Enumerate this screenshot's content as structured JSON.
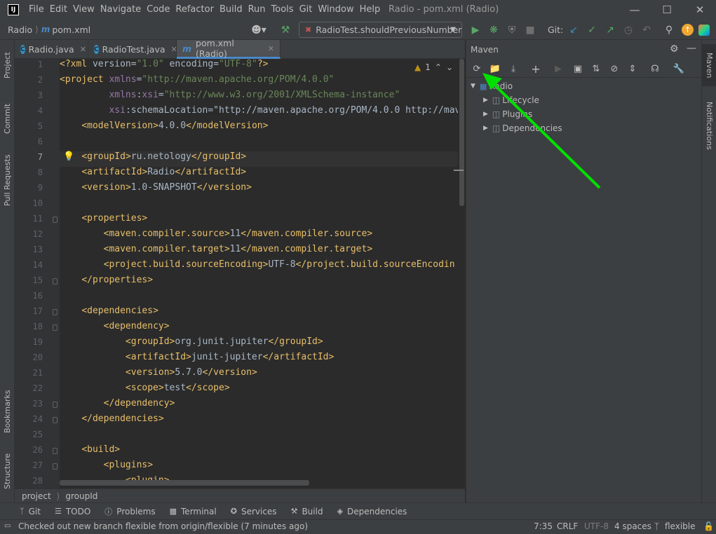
{
  "title_bar": {
    "menus": [
      "File",
      "Edit",
      "View",
      "Navigate",
      "Code",
      "Refactor",
      "Build",
      "Run",
      "Tools",
      "Git",
      "Window",
      "Help"
    ],
    "title": "Radio - pom.xml (Radio)"
  },
  "nav_bar": {
    "crumbs": [
      "Radio",
      "pom.xml"
    ],
    "run_config": "RadioTest.shouldPreviousNumber",
    "git_label": "Git:"
  },
  "left_strip": [
    "Project",
    "Commit",
    "Pull Requests",
    "Bookmarks",
    "Structure"
  ],
  "right_strip": [
    "Maven",
    "Notifications"
  ],
  "tabs": [
    {
      "label": "Radio.java",
      "icon": "C",
      "color": "#3592c4"
    },
    {
      "label": "RadioTest.java",
      "icon": "C",
      "color": "#3592c4"
    },
    {
      "label": "pom.xml (Radio)",
      "icon": "m",
      "color": "#4a88c7"
    }
  ],
  "editor": {
    "inspection": "1",
    "line_numbers": [
      "1",
      "2",
      "3",
      "4",
      "5",
      "6",
      "7",
      "8",
      "9",
      "10",
      "11",
      "12",
      "13",
      "14",
      "15",
      "16",
      "17",
      "18",
      "19",
      "20",
      "21",
      "22",
      "23",
      "24",
      "25",
      "26",
      "27",
      "28"
    ],
    "lines": [
      "<?xml version=\"1.0\" encoding=\"UTF-8\"?>",
      "<project xmlns=\"http://maven.apache.org/POM/4.0.0\"",
      "         xmlns:xsi=\"http://www.w3.org/2001/XMLSchema-instance\"",
      "         xsi:schemaLocation=\"http://maven.apache.org/POM/4.0.0 http://mav",
      "    <modelVersion>4.0.0</modelVersion>",
      "",
      "    <groupId>ru.netology</groupId>",
      "    <artifactId>Radio</artifactId>",
      "    <version>1.0-SNAPSHOT</version>",
      "",
      "    <properties>",
      "        <maven.compiler.source>11</maven.compiler.source>",
      "        <maven.compiler.target>11</maven.compiler.target>",
      "        <project.build.sourceEncoding>UTF-8</project.build.sourceEncodin",
      "    </properties>",
      "",
      "    <dependencies>",
      "        <dependency>",
      "            <groupId>org.junit.jupiter</groupId>",
      "            <artifactId>junit-jupiter</artifactId>",
      "            <version>5.7.0</version>",
      "            <scope>test</scope>",
      "        </dependency>",
      "    </dependencies>",
      "",
      "    <build>",
      "        <plugins>",
      "            <plugin>"
    ]
  },
  "breadcrumb": [
    "project",
    "groupId"
  ],
  "maven": {
    "title": "Maven",
    "root": "Radio",
    "children": [
      "Lifecycle",
      "Plugins",
      "Dependencies"
    ]
  },
  "bottom_tools": [
    {
      "label": "Git",
      "icon": "git-icon"
    },
    {
      "label": "TODO",
      "icon": "todo-icon"
    },
    {
      "label": "Problems",
      "icon": "problems-icon"
    },
    {
      "label": "Terminal",
      "icon": "terminal-icon"
    },
    {
      "label": "Services",
      "icon": "services-icon"
    },
    {
      "label": "Build",
      "icon": "build-icon"
    },
    {
      "label": "Dependencies",
      "icon": "dependencies-icon"
    }
  ],
  "status": {
    "message": "Checked out new branch flexible from origin/flexible (7 minutes ago)",
    "position": "7:35",
    "line_sep": "CRLF",
    "encoding": "UTF-8",
    "indent": "4 spaces",
    "branch": "flexible"
  },
  "colors": {
    "accent": "#4a88c7",
    "arrow": "#00e000",
    "run": "#59a869"
  }
}
